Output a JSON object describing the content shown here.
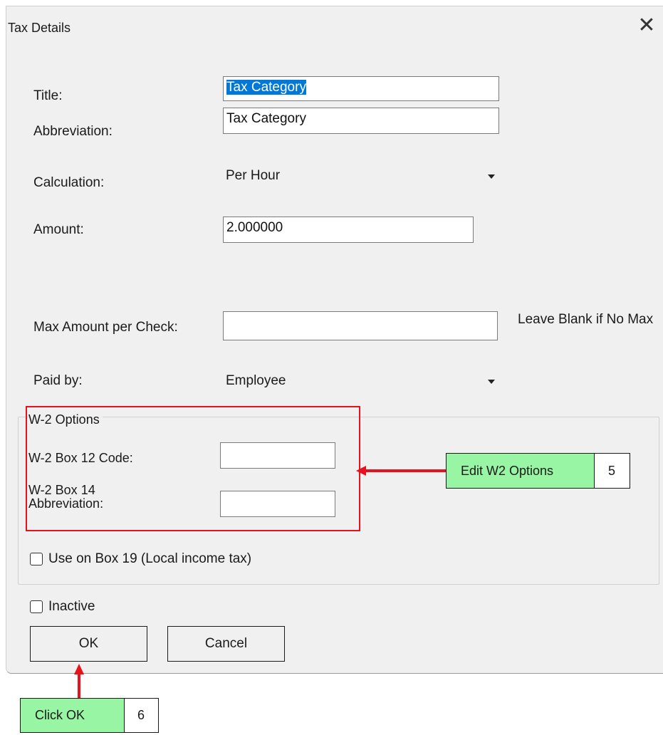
{
  "dialog": {
    "title": "Tax Details",
    "close_symbol": "✕"
  },
  "fields": {
    "title_label": "Title:",
    "title_value": "Tax Category",
    "abbreviation_label": "Abbreviation:",
    "abbreviation_value": "Tax Category",
    "calculation_label": "Calculation:",
    "calculation_value": "Per Hour",
    "amount_label": "Amount:",
    "amount_value": "2.000000",
    "max_amount_label": "Max Amount per Check:",
    "max_amount_value": "",
    "max_amount_hint": "Leave Blank if No Max",
    "paid_by_label": "Paid by:",
    "paid_by_value": "Employee"
  },
  "w2": {
    "group_title": "W-2 Options",
    "box12_label": "W-2 Box 12 Code:",
    "box12_value": "",
    "box14_label": "W-2 Box 14 Abbreviation:",
    "box14_value": "",
    "box19_label": "Use on Box 19 (Local income tax)"
  },
  "inactive_label": "Inactive",
  "buttons": {
    "ok": "OK",
    "cancel": "Cancel"
  },
  "callouts": {
    "w2": {
      "text": "Edit W2 Options",
      "step": "5"
    },
    "ok": {
      "text": "Click OK",
      "step": "6"
    }
  },
  "colors": {
    "annotation_red": "#e8121c",
    "callout_green": "#98f5a3",
    "selection_blue": "#0078d7"
  }
}
